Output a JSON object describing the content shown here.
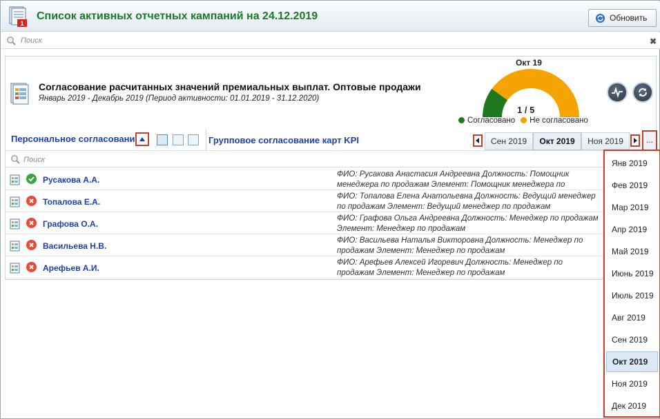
{
  "header": {
    "title": "Список активных отчетных кампаний на 24.12.2019",
    "refresh_label": "Обновить"
  },
  "search": {
    "placeholder": "Поиск"
  },
  "campaign": {
    "title": "Согласование расчитанных значений премиальных выплат. Оптовые продажи",
    "period": "Январь 2019   - Декабрь 2019 (Период активности: 01.01.2019 - 31.12.2020)",
    "gauge": {
      "month": "Окт 19",
      "count": "1 / 5",
      "approved_fraction": 0.2,
      "approved_color": "#1f7a1f",
      "pending_color": "#f5a300",
      "legend_approved": "Согласовано",
      "legend_pending": "Не согласовано"
    },
    "actions": {
      "chart_icon": "pulse-icon",
      "refresh_icon": "refresh-icon"
    },
    "tabs": {
      "personal": "Персональное согласование",
      "group": "Групповое согласование карт KPI"
    },
    "months_visible": [
      "Сен 2019",
      "Окт 2019",
      "Ноя 2019"
    ],
    "active_month": "Окт 2019",
    "more_label": "...",
    "inner_search_placeholder": "Поиск",
    "employees": [
      {
        "name": "Русакова А.А.",
        "status": "approved",
        "desc": "ФИО: Русакова Анастасия Андреевна  Должность: Помощник менеджера по продажам Элемент: Помощник менеджера по продажам"
      },
      {
        "name": "Топалова Е.А.",
        "status": "rejected",
        "desc": "ФИО: Топалова Елена Анатольевна  Должность: Ведущий менеджер по продажам Элемент: Ведущий менеджер по продажам"
      },
      {
        "name": "Графова О.А.",
        "status": "rejected",
        "desc": "ФИО: Графова Ольга Андреевна  Должность: Менеджер по продажам Элемент: Менеджер по продажам"
      },
      {
        "name": "Васильева Н.В.",
        "status": "rejected",
        "desc": "ФИО: Васильева Наталья Викторовна  Должность: Менеджер по продажам Элемент: Менеджер по продажам"
      },
      {
        "name": "Арефьев А.И.",
        "status": "rejected",
        "desc": "ФИО: Арефьев Алексей Игоревич  Должность: Менеджер по продажам Элемент: Менеджер по продажам"
      }
    ]
  },
  "month_dropdown": {
    "items": [
      "Янв 2019",
      "Фев 2019",
      "Мар 2019",
      "Апр 2019",
      "Май 2019",
      "Июнь 2019",
      "Июль 2019",
      "Авг 2019",
      "Сен 2019",
      "Окт 2019",
      "Ноя 2019",
      "Дек 2019"
    ],
    "selected": "Окт 2019"
  }
}
